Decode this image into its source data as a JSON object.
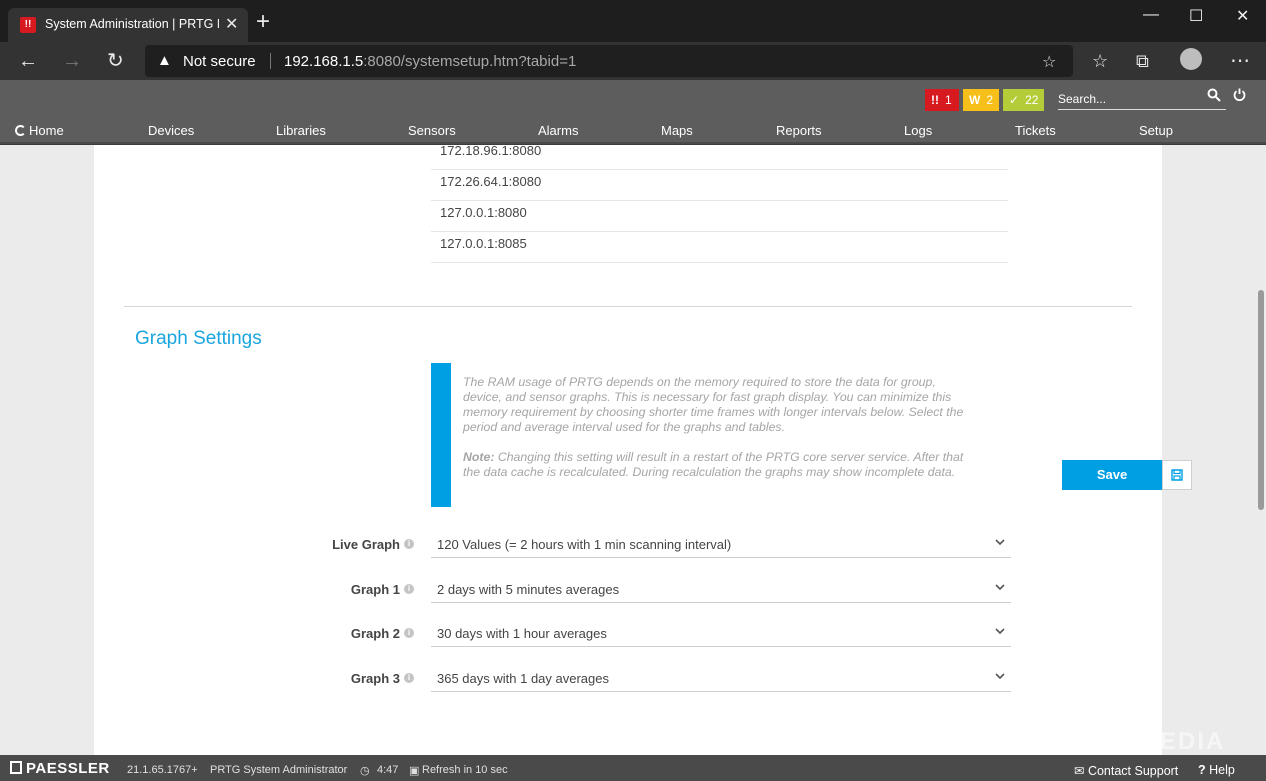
{
  "browser": {
    "tab_title": "System Administration | PRTG Ne",
    "favicon_text": "!!",
    "security_label": "Not secure",
    "url_host": "192.168.1.5",
    "url_rest": ":8080/systemsetup.htm?tabid=1"
  },
  "prtg_header": {
    "alarms_red": "1",
    "alarms_red_icon": "!!",
    "warnings": "2",
    "warnings_icon": "W",
    "ok_count": "22",
    "ok_icon": "✓",
    "search_placeholder": "Search..."
  },
  "menu": {
    "items": [
      "Home",
      "Devices",
      "Libraries",
      "Sensors",
      "Alarms",
      "Maps",
      "Reports",
      "Logs",
      "Tickets",
      "Setup"
    ]
  },
  "bindings": {
    "ips": [
      "172.18.96.1:8080",
      "172.26.64.1:8080",
      "127.0.0.1:8080",
      "127.0.0.1:8085"
    ]
  },
  "graph_settings": {
    "title": "Graph Settings",
    "info_text": "The RAM usage of PRTG depends on the memory required to store the data for group, device, and sensor graphs. This is necessary for fast graph display. You can minimize this memory requirement by choosing shorter time frames with longer intervals below. Select the period and average interval used for the graphs and tables.",
    "note_label": "Note:",
    "note_text": " Changing this setting will result in a restart of the PRTG core server service. After that the data cache is recalculated. During recalculation the graphs may show incomplete data.",
    "fields": [
      {
        "label": "Live Graph",
        "value": "120 Values (= 2 hours with 1 min scanning interval)"
      },
      {
        "label": "Graph 1",
        "value": "2 days with 5 minutes averages"
      },
      {
        "label": "Graph 2",
        "value": "30 days with 1 hour averages"
      },
      {
        "label": "Graph 3",
        "value": "365 days with 1 day averages"
      }
    ],
    "save_label": "Save",
    "info_icon": "i"
  },
  "footer": {
    "brand": "PAESSLER",
    "version": "21.1.65.1767+",
    "user": "PRTG System Administrator",
    "time": "4:47",
    "refresh": "Refresh in 10 sec",
    "contact": "Contact Support",
    "help": "Help"
  },
  "watermark": "SOFTPEDIA",
  "colors": {
    "accent": "#009fe3",
    "title_blue": "#1ba5df",
    "alarm_red": "#d71920",
    "warning_yellow": "#f7bf1a",
    "ok_green": "#b4cc38",
    "header_gray": "#5d5d5d"
  }
}
